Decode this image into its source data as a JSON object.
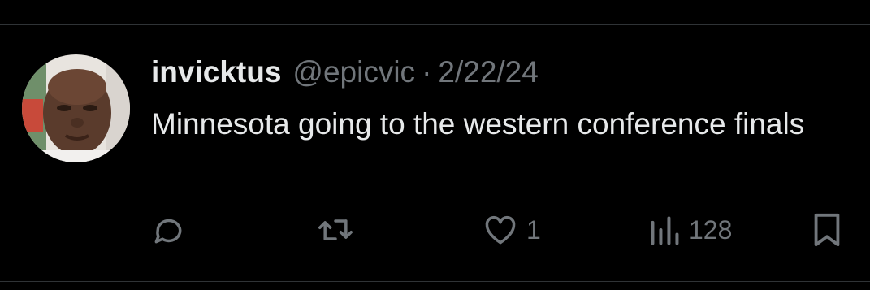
{
  "tweet": {
    "display_name": "invicktus",
    "handle": "@epicvic",
    "separator": "·",
    "date": "2/22/24",
    "text": "Minnesota going to the western conference finals"
  },
  "actions": {
    "reply_icon": "reply-icon",
    "retweet_icon": "retweet-icon",
    "like_icon": "heart-icon",
    "like_count": "1",
    "views_icon": "views-icon",
    "views_count": "128",
    "bookmark_icon": "bookmark-icon"
  },
  "colors": {
    "background": "#000000",
    "text_primary": "#e7e9ea",
    "text_secondary": "#71767b",
    "divider": "#2f3336"
  }
}
